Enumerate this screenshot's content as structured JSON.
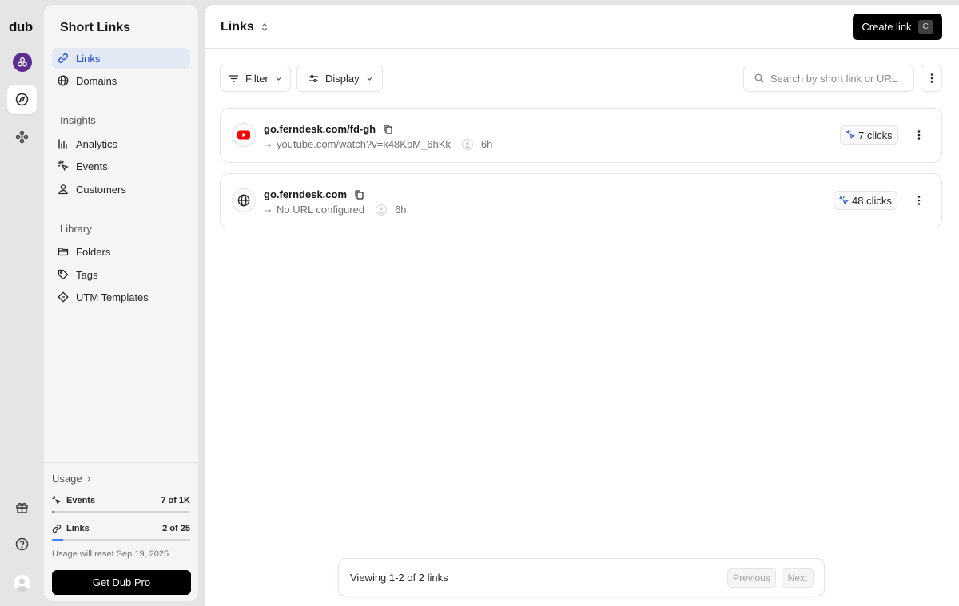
{
  "rail": {
    "logo": "dub",
    "icons": [
      "workspace-logo",
      "compass-icon",
      "integrations-icon",
      "gift-icon",
      "help-icon",
      "user-avatar"
    ]
  },
  "sidebar": {
    "title": "Short Links",
    "items": [
      {
        "label": "Links",
        "icon": "link-icon",
        "active": true
      },
      {
        "label": "Domains",
        "icon": "globe-icon"
      }
    ],
    "insights": {
      "heading": "Insights",
      "items": [
        {
          "label": "Analytics",
          "icon": "chart-icon"
        },
        {
          "label": "Events",
          "icon": "cursor-rays-icon"
        },
        {
          "label": "Customers",
          "icon": "user-icon"
        }
      ]
    },
    "library": {
      "heading": "Library",
      "items": [
        {
          "label": "Folders",
          "icon": "folder-icon"
        },
        {
          "label": "Tags",
          "icon": "tag-icon"
        },
        {
          "label": "UTM Templates",
          "icon": "diamond-icon"
        }
      ]
    },
    "usage": {
      "heading": "Usage",
      "events": {
        "label": "Events",
        "value": "7 of 1K",
        "fraction": 0.007
      },
      "links": {
        "label": "Links",
        "value": "2 of 25",
        "fraction": 0.08
      },
      "reset_note": "Usage will reset Sep 19, 2025",
      "cta": "Get Dub Pro"
    }
  },
  "header": {
    "title": "Links",
    "create_label": "Create link",
    "create_shortcut": "C"
  },
  "toolbar": {
    "filter_label": "Filter",
    "display_label": "Display",
    "search_placeholder": "Search by short link or URL"
  },
  "links": [
    {
      "short": "go.ferndesk.com/fd-gh",
      "destination": "youtube.com/watch?v=k48KbM_6hKk",
      "age": "6h",
      "clicks": "7 clicks",
      "favicon": "youtube-icon"
    },
    {
      "short": "go.ferndesk.com",
      "destination": "No URL configured",
      "age": "6h",
      "clicks": "48 clicks",
      "favicon": "globe-icon"
    }
  ],
  "pagination": {
    "summary": "Viewing 1-2 of 2 links",
    "prev_label": "Previous",
    "next_label": "Next"
  },
  "colors": {
    "accent": "#1d4ed8",
    "active_bg": "#e3e8f5",
    "primary_button": "#000000",
    "workspace": "#5b2c91",
    "youtube": "#ff0000"
  }
}
